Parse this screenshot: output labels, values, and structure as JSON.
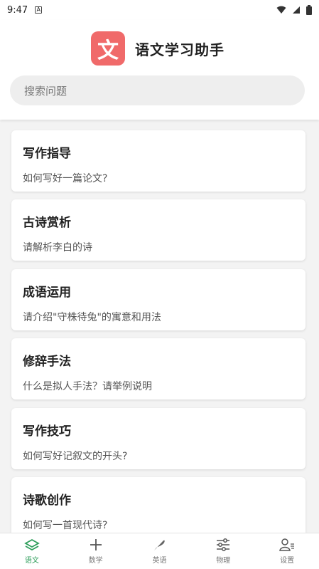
{
  "status": {
    "time": "9:47",
    "a_badge": "A"
  },
  "header": {
    "logo_char": "文",
    "title": "语文学习助手"
  },
  "search": {
    "placeholder": "搜索问题"
  },
  "cards": [
    {
      "title": "写作指导",
      "subtitle": "如何写好一篇论文?"
    },
    {
      "title": "古诗赏析",
      "subtitle": "请解析李白的诗"
    },
    {
      "title": "成语运用",
      "subtitle": "请介绍\"守株待兔\"的寓意和用法"
    },
    {
      "title": "修辞手法",
      "subtitle": "什么是拟人手法？请举例说明"
    },
    {
      "title": "写作技巧",
      "subtitle": "如何写好记叙文的开头?"
    },
    {
      "title": "诗歌创作",
      "subtitle": "如何写一首现代诗?"
    }
  ],
  "nav": [
    {
      "label": "语文",
      "icon": "layers-icon",
      "active": true
    },
    {
      "label": "数学",
      "icon": "plus-icon",
      "active": false
    },
    {
      "label": "英语",
      "icon": "feather-icon",
      "active": false
    },
    {
      "label": "物理",
      "icon": "sliders-icon",
      "active": false
    },
    {
      "label": "设置",
      "icon": "user-settings-icon",
      "active": false
    }
  ],
  "colors": {
    "logo": "#f06a6a",
    "active_nav": "#2e9e5b"
  }
}
